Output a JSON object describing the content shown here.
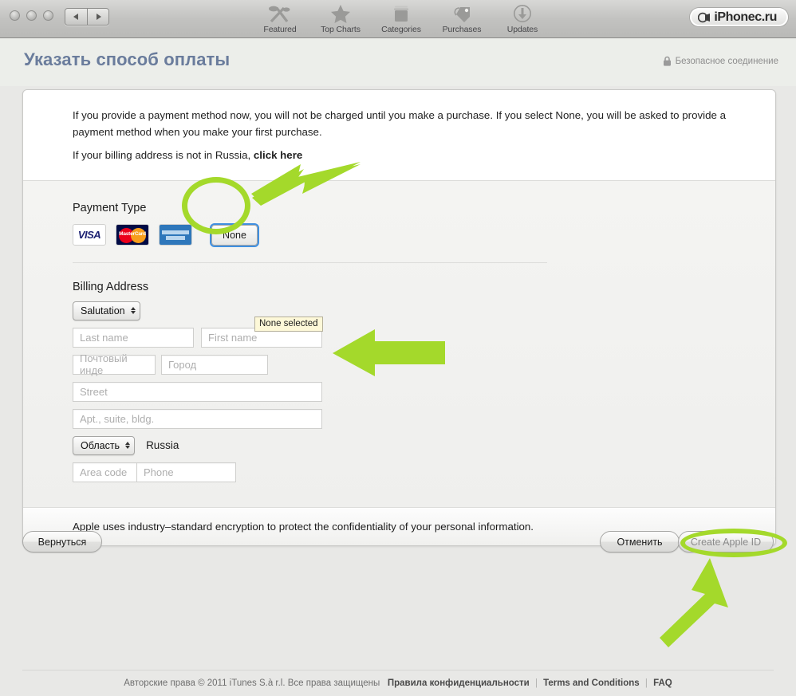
{
  "toolbar": {
    "window_dots": [
      "close",
      "minimize",
      "zoom"
    ],
    "nav": {
      "back_label": "◀",
      "forward_label": "▶"
    },
    "tabs": [
      {
        "label": "Featured",
        "icon": "featured-star-icon"
      },
      {
        "label": "Top Charts",
        "icon": "star-icon"
      },
      {
        "label": "Categories",
        "icon": "box-icon"
      },
      {
        "label": "Purchases",
        "icon": "tag-icon"
      },
      {
        "label": "Updates",
        "icon": "download-arrow-icon"
      }
    ],
    "brand": {
      "text": "iPhonec.ru",
      "icon": "site-logo-icon"
    }
  },
  "header": {
    "title": "Указать способ оплаты",
    "secure_text": "Безопасное соединение",
    "secure_icon": "lock-icon"
  },
  "intro": {
    "paragraph1": "If you provide a payment method now, you will not be charged until you make a purchase. If you select None, you will be asked to provide a payment method when you make your first purchase.",
    "paragraph2_prefix": "If your billing address is not in Russia, ",
    "paragraph2_link": "click here"
  },
  "payment": {
    "section_label": "Payment Type",
    "cards": [
      {
        "name": "visa",
        "label": "VISA"
      },
      {
        "name": "mastercard",
        "label": "MasterCard"
      },
      {
        "name": "amex",
        "label": "AMERICAN EXPRESS"
      }
    ],
    "none_button_label": "None",
    "tooltip_text": "None selected"
  },
  "billing": {
    "section_label": "Billing Address",
    "salutation_label": "Salutation",
    "last_name_placeholder": "Last name",
    "first_name_placeholder": "First name",
    "zip_placeholder": "Почтовый инде",
    "city_placeholder": "Город",
    "street_placeholder": "Street",
    "apt_placeholder": "Apt., suite, bldg.",
    "region_label": "Область",
    "country_text": "Russia",
    "area_code_placeholder": "Area code",
    "phone_placeholder": "Phone"
  },
  "panel_footer": {
    "text": "Apple uses industry–standard encryption to protect the confidentiality of your personal information."
  },
  "actions": {
    "back_label": "Вернуться",
    "cancel_label": "Отменить",
    "create_label": "Create Apple ID"
  },
  "footer": {
    "copyright": "Авторские права © 2011 iTunes S.à r.l. Все права защищены",
    "privacy": "Правила конфиденциальности",
    "terms": "Terms and Conditions",
    "faq": "FAQ",
    "separator": "|"
  },
  "annotations": {
    "highlight_color": "#a4d92b",
    "arrow_to_none": "arrow-pointing-left-to-none-button",
    "arrow_to_form": "arrow-pointing-left-to-billing-form",
    "arrow_to_create": "arrow-pointing-up-to-create-apple-id",
    "circle_none": "circle-around-none-button",
    "circle_create": "circle-around-create-apple-id-button"
  }
}
